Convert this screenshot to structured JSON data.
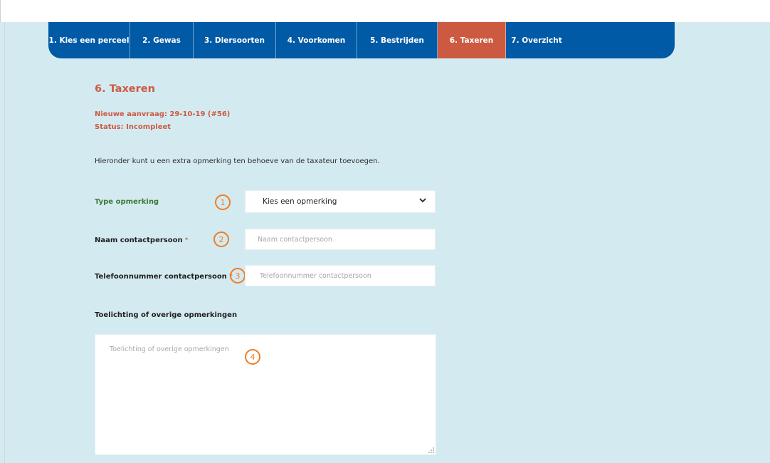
{
  "steps": [
    {
      "label": "1. Kies een perceel"
    },
    {
      "label": "2. Gewas"
    },
    {
      "label": "3. Diersoorten"
    },
    {
      "label": "4. Voorkomen"
    },
    {
      "label": "5. Bestrijden"
    },
    {
      "label": "6. Taxeren"
    },
    {
      "label": "7. Overzicht"
    }
  ],
  "active_step": "6. Taxeren",
  "page": {
    "title": "6. Taxeren",
    "request": "Nieuwe aanvraag: 29-10-19 (#56)",
    "status": "Status: Incompleet",
    "intro": "Hieronder kunt u een extra opmerking ten behoeve van de taxateur toevoegen."
  },
  "form": {
    "type": {
      "label": "Type opmerking",
      "selected": "Kies een opmerking",
      "marker": "1"
    },
    "name": {
      "label": "Naam contactpersoon",
      "required_mark": "*",
      "placeholder": "Naam contactpersoon",
      "value": "",
      "marker": "2"
    },
    "phone": {
      "label": "Telefoonnummer contactpersoon",
      "required_mark": "*",
      "placeholder": "Telefoonnummer contactpersoon",
      "value": "",
      "marker": "3"
    },
    "notes": {
      "label": "Toelichting of overige opmerkingen",
      "placeholder": "Toelichting of overige opmerkingen",
      "value": "",
      "marker": "4"
    }
  },
  "colors": {
    "nav_bg": "#005aa6",
    "nav_active": "#cc5a41",
    "page_bg": "#d4eaf1",
    "heading": "#cc5a41",
    "label_green": "#3c7a34",
    "marker": "#ef7d22"
  },
  "icons": {
    "select_arrow": "chevron-down-icon",
    "resize": "resize-grip-icon"
  }
}
